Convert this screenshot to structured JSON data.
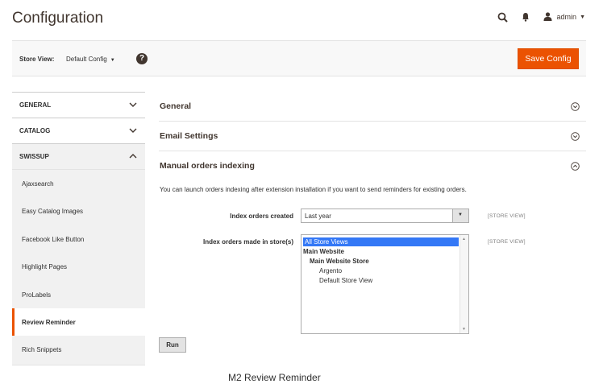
{
  "header": {
    "title": "Configuration",
    "user_label": "admin",
    "search_icon": "search-icon",
    "bell_icon": "bell-icon",
    "user_icon": "user-icon"
  },
  "scope": {
    "label": "Store View:",
    "selected": "Default Config",
    "help": "?",
    "save_label": "Save Config"
  },
  "colors": {
    "accent": "#eb5202",
    "selection": "#3478f6"
  },
  "sidebar": {
    "tabs": [
      {
        "label": "GENERAL",
        "state": "collapsed"
      },
      {
        "label": "CATALOG",
        "state": "collapsed"
      },
      {
        "label": "SWISSUP",
        "state": "expanded"
      }
    ],
    "items": [
      {
        "label": "Ajaxsearch"
      },
      {
        "label": "Easy Catalog Images"
      },
      {
        "label": "Facebook Like Button"
      },
      {
        "label": "Highlight Pages"
      },
      {
        "label": "ProLabels"
      },
      {
        "label": "Review Reminder",
        "active": true
      },
      {
        "label": "Rich Snippets"
      }
    ]
  },
  "sections": [
    {
      "title": "General",
      "state": "collapsed"
    },
    {
      "title": "Email Settings",
      "state": "collapsed"
    },
    {
      "title": "Manual orders indexing",
      "state": "expanded"
    }
  ],
  "indexing": {
    "intro": "You can launch orders indexing after extension installation if you want to send reminders for existing orders.",
    "created_label": "Index orders created",
    "created_value": "Last year",
    "stores_label": "Index orders made in store(s)",
    "scope_note": "[STORE VIEW]",
    "store_options": [
      {
        "label": "All Store Views",
        "selected": true,
        "indent": 0,
        "bold": false
      },
      {
        "label": "Main Website",
        "selected": false,
        "indent": 0,
        "bold": true
      },
      {
        "label": "Main Website Store",
        "selected": false,
        "indent": 1,
        "bold": true
      },
      {
        "label": "Argento",
        "selected": false,
        "indent": 2,
        "bold": false
      },
      {
        "label": "Default Store View",
        "selected": false,
        "indent": 2,
        "bold": false
      }
    ],
    "run_label": "Run"
  },
  "caption": "M2 Review Reminder"
}
